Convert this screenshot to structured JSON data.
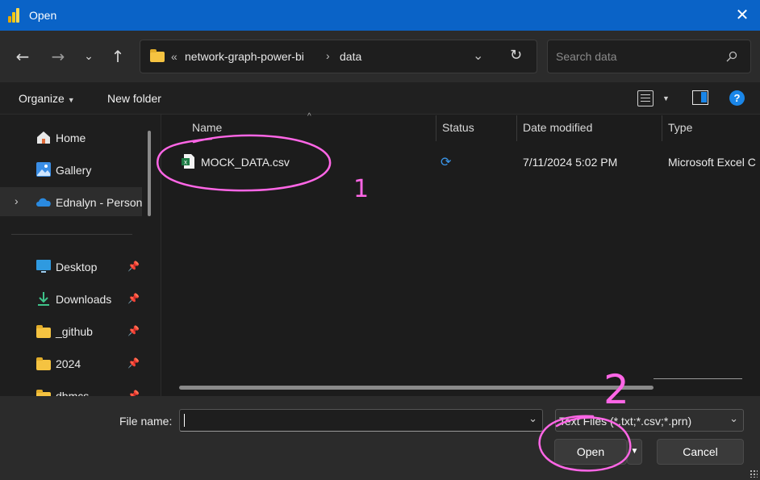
{
  "window": {
    "title": "Open"
  },
  "nav": {
    "path_overflow": "«",
    "breadcrumbs": [
      "network-graph-power-bi",
      "data"
    ],
    "search_placeholder": "Search data"
  },
  "commands": {
    "organize": "Organize",
    "new_folder": "New folder"
  },
  "sidebar": {
    "items": [
      {
        "label": "Home",
        "icon": "home-icon"
      },
      {
        "label": "Gallery",
        "icon": "gallery-icon"
      },
      {
        "label": "Ednalyn - Person",
        "icon": "onedrive-icon"
      },
      {
        "label": "Desktop",
        "icon": "desktop-icon"
      },
      {
        "label": "Downloads",
        "icon": "downloads-icon"
      },
      {
        "label": "_github",
        "icon": "folder-icon"
      },
      {
        "label": "2024",
        "icon": "folder-icon"
      },
      {
        "label": "dbmcs",
        "icon": "folder-icon"
      }
    ]
  },
  "columns": {
    "name": "Name",
    "status": "Status",
    "date": "Date modified",
    "type": "Type"
  },
  "files": [
    {
      "name": "MOCK_DATA.csv",
      "status_icon": "sync-icon",
      "date": "7/11/2024 5:02 PM",
      "type": "Microsoft Excel C"
    }
  ],
  "footer": {
    "file_name_label": "File name:",
    "file_name_value": "",
    "file_type": "Text Files (*.txt;*.csv;*.prn)",
    "open_label": "Open",
    "cancel_label": "Cancel"
  },
  "annotations": {
    "one": "1",
    "two": "2"
  },
  "colors": {
    "titlebar": "#0a63c7",
    "accent": "#1a86e8",
    "annotation": "#ff66e6"
  }
}
